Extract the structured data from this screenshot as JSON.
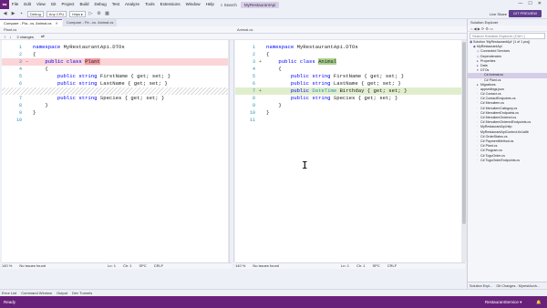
{
  "menubar": {
    "logo": "∞",
    "items": [
      "File",
      "Edit",
      "View",
      "Git",
      "Project",
      "Build",
      "Debug",
      "Test",
      "Analyze",
      "Tools",
      "Extensions",
      "Window",
      "Help"
    ],
    "search": "⌕ Search",
    "app_title": "MyRestaurantApi",
    "window_controls": [
      "—",
      "☐",
      "✕"
    ]
  },
  "toolbar": {
    "config": "Debug",
    "platform": "Any CPU",
    "run_profile": "https ▸",
    "live_share": "Live Share",
    "preview": "GIT PREVIEW"
  },
  "tabs": [
    {
      "label": "Compare - Pla...vs. Animal.cs",
      "active": true
    },
    {
      "label": "Compare - Pe...vs. Animal.cs",
      "active": false
    }
  ],
  "left_file": "Plant.cs",
  "right_file": "Animal.cs",
  "nav": {
    "changes": "2 changes"
  },
  "left_code": [
    {
      "ln": "1",
      "mark": "",
      "tokens": [
        {
          "t": "namespace ",
          "c": "kw"
        },
        {
          "t": "MyRestaurantApi.DTOs",
          "c": ""
        }
      ],
      "cls": ""
    },
    {
      "ln": "2",
      "mark": "",
      "tokens": [
        {
          "t": "{",
          "c": ""
        }
      ],
      "cls": ""
    },
    {
      "ln": "3",
      "mark": "−",
      "tokens": [
        {
          "t": "    public class ",
          "c": "kw"
        },
        {
          "t": "Plant",
          "c": "rm-word"
        }
      ],
      "cls": "rm-line"
    },
    {
      "ln": "4",
      "mark": "",
      "tokens": [
        {
          "t": "    {",
          "c": ""
        }
      ],
      "cls": ""
    },
    {
      "ln": "5",
      "mark": "",
      "tokens": [
        {
          "t": "        public string ",
          "c": "kw"
        },
        {
          "t": "FirstName { get; set; }",
          "c": ""
        }
      ],
      "cls": ""
    },
    {
      "ln": "6",
      "mark": "",
      "tokens": [
        {
          "t": "        public string ",
          "c": "kw"
        },
        {
          "t": "LastName { get; set; }",
          "c": ""
        }
      ],
      "cls": ""
    },
    {
      "ln": "",
      "mark": "",
      "tokens": [],
      "cls": "hatch"
    },
    {
      "ln": "7",
      "mark": "",
      "tokens": [
        {
          "t": "        public string ",
          "c": "kw"
        },
        {
          "t": "Species { get; set; }",
          "c": ""
        }
      ],
      "cls": ""
    },
    {
      "ln": "8",
      "mark": "",
      "tokens": [
        {
          "t": "    }",
          "c": ""
        }
      ],
      "cls": ""
    },
    {
      "ln": "9",
      "mark": "",
      "tokens": [
        {
          "t": "}",
          "c": ""
        }
      ],
      "cls": ""
    },
    {
      "ln": "10",
      "mark": "",
      "tokens": [],
      "cls": ""
    }
  ],
  "right_code": [
    {
      "ln": "1",
      "mark": "",
      "tokens": [
        {
          "t": "namespace ",
          "c": "kw"
        },
        {
          "t": "MyRestaurantApi.DTOs",
          "c": ""
        }
      ],
      "cls": ""
    },
    {
      "ln": "2",
      "mark": "",
      "tokens": [
        {
          "t": "{",
          "c": ""
        }
      ],
      "cls": ""
    },
    {
      "ln": "3",
      "mark": "+",
      "tokens": [
        {
          "t": "    public class ",
          "c": "kw"
        },
        {
          "t": "Animal",
          "c": "add-word"
        }
      ],
      "cls": ""
    },
    {
      "ln": "4",
      "mark": "",
      "tokens": [
        {
          "t": "    {",
          "c": ""
        }
      ],
      "cls": ""
    },
    {
      "ln": "5",
      "mark": "",
      "tokens": [
        {
          "t": "        public string ",
          "c": "kw"
        },
        {
          "t": "FirstName { get; set; }",
          "c": ""
        }
      ],
      "cls": ""
    },
    {
      "ln": "6",
      "mark": "",
      "tokens": [
        {
          "t": "        public string ",
          "c": "kw"
        },
        {
          "t": "LastName { get; set; }",
          "c": ""
        }
      ],
      "cls": ""
    },
    {
      "ln": "7",
      "mark": "+",
      "tokens": [
        {
          "t": "        public ",
          "c": "kw"
        },
        {
          "t": "DateTime ",
          "c": "tp"
        },
        {
          "t": "Birthday { get; set; }",
          "c": ""
        }
      ],
      "cls": "add-line"
    },
    {
      "ln": "8",
      "mark": "",
      "tokens": [
        {
          "t": "        public string ",
          "c": "kw"
        },
        {
          "t": "Species { get; set; }",
          "c": ""
        }
      ],
      "cls": ""
    },
    {
      "ln": "9",
      "mark": "",
      "tokens": [
        {
          "t": "    }",
          "c": ""
        }
      ],
      "cls": ""
    },
    {
      "ln": "10",
      "mark": "",
      "tokens": [
        {
          "t": "}",
          "c": ""
        }
      ],
      "cls": ""
    },
    {
      "ln": "11",
      "mark": "",
      "tokens": [],
      "cls": ""
    }
  ],
  "left_status": {
    "zoom": "140 %",
    "issues": "No issues found",
    "ln": "Ln: 1",
    "ch": "Ch: 1",
    "enc": "SPC",
    "eol": "CRLF"
  },
  "right_status": {
    "zoom": "140 %",
    "issues": "No issues found",
    "ln": "Ln: 1",
    "ch": "Ch: 1",
    "enc": "SPC",
    "eol": "CRLF"
  },
  "solution": {
    "title": "Solution Explorer",
    "search": "Search Solution Explorer (Ctrl+;)",
    "items": [
      {
        "label": "Solution 'MyRestaurantApi' (1 of 1 proj)",
        "icon": "▣",
        "indent": 0,
        "sel": false
      },
      {
        "label": "MyRestaurantApi",
        "icon": "◆",
        "indent": 1,
        "sel": false
      },
      {
        "label": "Connected Services",
        "icon": "◇",
        "indent": 2,
        "sel": false
      },
      {
        "label": "Dependencies",
        "icon": "◇",
        "indent": 2,
        "sel": false
      },
      {
        "label": "Properties",
        "icon": "▸",
        "indent": 2,
        "sel": false
      },
      {
        "label": "Data",
        "icon": "▸",
        "indent": 2,
        "sel": false
      },
      {
        "label": "DTOs",
        "icon": "▾",
        "indent": 2,
        "sel": false
      },
      {
        "label": "C# Animal.cs",
        "icon": "·",
        "indent": 3,
        "sel": true
      },
      {
        "label": "C# Plant.cs",
        "icon": "·",
        "indent": 3,
        "sel": false
      },
      {
        "label": "Migrations",
        "icon": "▸",
        "indent": 2,
        "sel": false
      },
      {
        "label": "appsettings.json",
        "icon": "·",
        "indent": 2,
        "sel": false
      },
      {
        "label": "C# Contact.cs",
        "icon": "·",
        "indent": 2,
        "sel": false
      },
      {
        "label": "C# ContactEndpoints.cs",
        "icon": "·",
        "indent": 2,
        "sel": false
      },
      {
        "label": "C# Menuitem.cs",
        "icon": "·",
        "indent": 2,
        "sel": false
      },
      {
        "label": "C# MenuitemCategory.cs",
        "icon": "·",
        "indent": 2,
        "sel": false
      },
      {
        "label": "C# MenuitemEndpoints.cs",
        "icon": "·",
        "indent": 2,
        "sel": false
      },
      {
        "label": "C# MenuitemOrdered.cs",
        "icon": "·",
        "indent": 2,
        "sel": false
      },
      {
        "label": "C# MenuitemOrderedEndpoints.cs",
        "icon": "·",
        "indent": 2,
        "sel": false
      },
      {
        "label": "MyRestaurantApi.http",
        "icon": "·",
        "indent": 2,
        "sel": false
      },
      {
        "label": "MyRestaurantApiContext-tin1a5b",
        "icon": "·",
        "indent": 2,
        "sel": false
      },
      {
        "label": "C# OrderStatus.cs",
        "icon": "·",
        "indent": 2,
        "sel": false
      },
      {
        "label": "C# PaymentMethod.cs",
        "icon": "·",
        "indent": 2,
        "sel": false
      },
      {
        "label": "C# Plant.cs",
        "icon": "·",
        "indent": 2,
        "sel": false
      },
      {
        "label": "C# Program.cs",
        "icon": "·",
        "indent": 2,
        "sel": false
      },
      {
        "label": "C# TogoOrder.cs",
        "icon": "·",
        "indent": 2,
        "sel": false
      },
      {
        "label": "C# TogoOrderEndpoints.cs",
        "icon": "·",
        "indent": 2,
        "sel": false
      }
    ],
    "bottom_tabs": [
      "Solution Expl...",
      "Git Changes - MyrestAcnh..."
    ]
  },
  "output_tabs": [
    "Error List",
    "Command Window",
    "Output",
    "Dev Tunnels"
  ],
  "status": {
    "ready": "Ready",
    "branch": "RestaurantService ▾",
    "bell": "🔔"
  }
}
